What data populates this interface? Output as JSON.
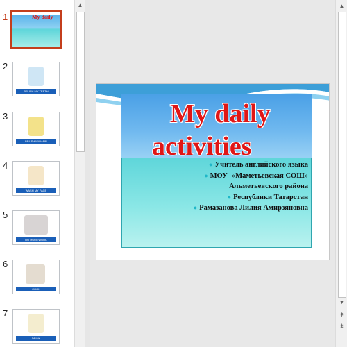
{
  "thumbnails": [
    {
      "number": "1",
      "caption": ""
    },
    {
      "number": "2",
      "caption": "BRUSH MY TEETH"
    },
    {
      "number": "3",
      "caption": "BRUSH MY HAIR"
    },
    {
      "number": "4",
      "caption": "WASH MY FACE"
    },
    {
      "number": "5",
      "caption": "DO HOMEWORK"
    },
    {
      "number": "6",
      "caption": "COOK"
    },
    {
      "number": "7",
      "caption": "DRINK"
    }
  ],
  "slide": {
    "title_line1": "My daily",
    "title_line2": "activities",
    "bullets": [
      "Учитель английского языка",
      "МОУ- «Маметьевская СОШ»",
      "Альметьевского района",
      "Республики Татарстан",
      "Рамазанова Лилия Амирзяновна"
    ]
  },
  "colors": {
    "selection": "#c43e1c",
    "title_red": "#e01616",
    "accent_cyan": "#1fb7c8"
  },
  "icons": {
    "scroll_up": "▲",
    "scroll_down": "▼",
    "prev_slide": "⇞",
    "next_slide": "⇟"
  }
}
